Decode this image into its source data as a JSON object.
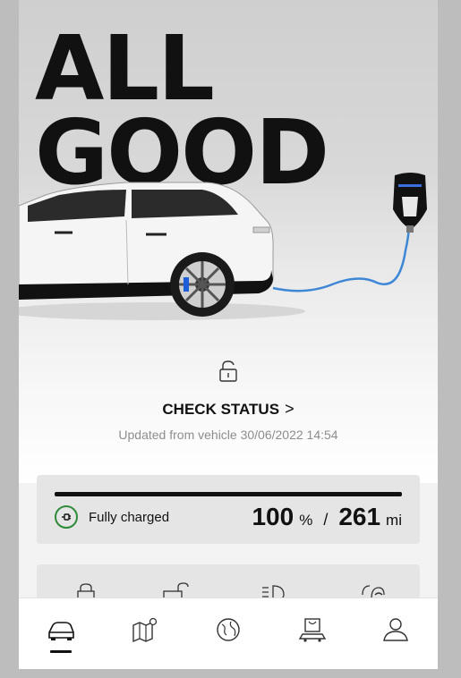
{
  "hero": {
    "headline_line1": "ALL",
    "headline_line2": "GOOD"
  },
  "status": {
    "lock_icon": "lock-open-icon",
    "check_label": "CHECK STATUS",
    "chevron": ">",
    "updated_text": "Updated from vehicle 30/06/2022 14:54"
  },
  "charging": {
    "label": "Fully charged",
    "charge_value": "100",
    "charge_unit": "%",
    "separator": "/",
    "range_value": "261",
    "range_unit": "mi",
    "charge_fraction": 1.0,
    "status_color": "#2e8b3a"
  },
  "controls": {
    "items": [
      "lock-icon",
      "unlock-icon",
      "headlight-icon",
      "climate-icon"
    ]
  },
  "tabs": [
    {
      "name": "vehicle",
      "icon": "car-icon",
      "active": true
    },
    {
      "name": "map",
      "icon": "map-icon",
      "active": false
    },
    {
      "name": "explore",
      "icon": "globe-icon",
      "active": false
    },
    {
      "name": "shop",
      "icon": "shop-icon",
      "active": false
    },
    {
      "name": "profile",
      "icon": "profile-icon",
      "active": false
    }
  ]
}
